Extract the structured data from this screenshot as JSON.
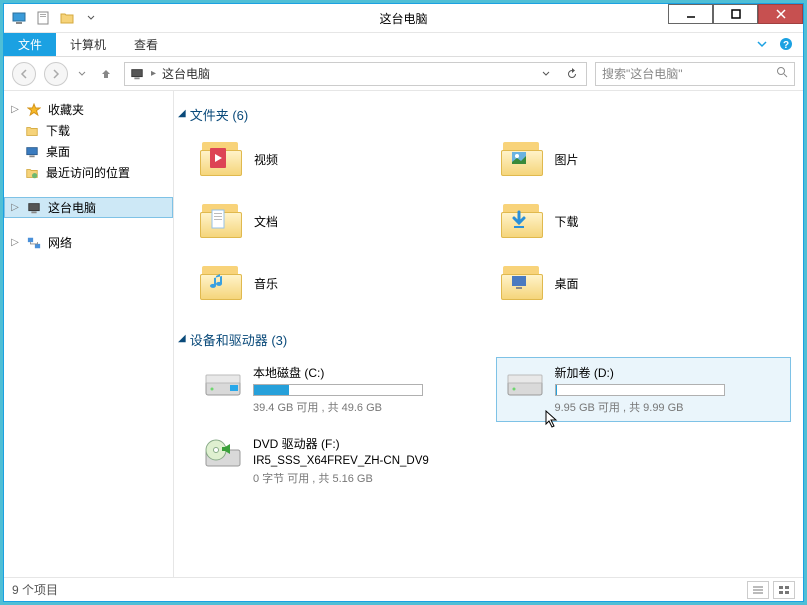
{
  "titlebar": {
    "title": "这台电脑"
  },
  "ribbon": {
    "file": "文件",
    "computer": "计算机",
    "view": "查看"
  },
  "address": {
    "location": "这台电脑",
    "search_placeholder": "搜索\"这台电脑\""
  },
  "sidebar": {
    "favorites": {
      "label": "收藏夹"
    },
    "downloads": {
      "label": "下载"
    },
    "desktop": {
      "label": "桌面"
    },
    "recent": {
      "label": "最近访问的位置"
    },
    "this_pc": {
      "label": "这台电脑"
    },
    "network": {
      "label": "网络"
    }
  },
  "sections": {
    "folders_header": "文件夹 (6)",
    "drives_header": "设备和驱动器 (3)"
  },
  "folders": {
    "videos": "视频",
    "pictures": "图片",
    "documents": "文档",
    "downloads": "下载",
    "music": "音乐",
    "desktop": "桌面"
  },
  "drives": {
    "c": {
      "name": "本地磁盘 (C:)",
      "meta": "39.4 GB 可用 , 共 49.6 GB",
      "fill_pct": 21
    },
    "d": {
      "name": "新加卷 (D:)",
      "meta": "9.95 GB 可用 , 共 9.99 GB",
      "fill_pct": 1
    },
    "f": {
      "name": "DVD 驱动器 (F:)",
      "subname": "IR5_SSS_X64FREV_ZH-CN_DV9",
      "meta": "0 字节 可用 , 共 5.16 GB"
    }
  },
  "statusbar": {
    "count": "9 个项目"
  }
}
